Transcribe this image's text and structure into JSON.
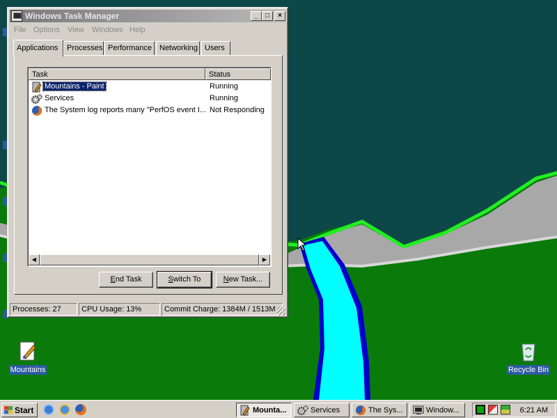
{
  "desktop": {
    "icons": [
      {
        "label": "Mountains"
      },
      {
        "label": "Recycle Bin"
      }
    ]
  },
  "window": {
    "title": "Windows Task Manager",
    "controls": {
      "minimize": "_",
      "maximize": "□",
      "close": "×"
    },
    "menu": [
      "File",
      "Options",
      "View",
      "Windows",
      "Help"
    ],
    "tabs": [
      "Applications",
      "Processes",
      "Performance",
      "Networking",
      "Users"
    ],
    "active_tab": "Applications",
    "columns": [
      "Task",
      "Status"
    ],
    "tasks": [
      {
        "name": "Mountains - Paint",
        "status": "Running",
        "icon": "paint-icon",
        "selected": true
      },
      {
        "name": "Services",
        "status": "Running",
        "icon": "services-gear-icon",
        "selected": false
      },
      {
        "name": "The System log reports many \"PerfOS event I...",
        "status": "Not Responding",
        "icon": "firefox-icon",
        "selected": false
      }
    ],
    "buttons": {
      "end_task": {
        "pre": "",
        "u": "E",
        "post": "nd Task"
      },
      "switch_to": {
        "pre": "",
        "u": "S",
        "post": "witch To"
      },
      "new_task": {
        "pre": "",
        "u": "N",
        "post": "ew Task..."
      }
    },
    "statusbar": {
      "processes": "Processes: 27",
      "cpu": "CPU Usage: 13%",
      "commit": "Commit Charge: 1384M / 1513M"
    }
  },
  "taskbar": {
    "start": "Start",
    "quick_launch": [
      "ie-icon",
      "ie-icon",
      "firefox-icon"
    ],
    "buttons": [
      {
        "label": "Mounta...",
        "icon": "paint-icon",
        "pressed": true
      },
      {
        "label": "Services",
        "icon": "services-gear-icon",
        "pressed": false
      },
      {
        "label": "The Sys...",
        "icon": "firefox-icon",
        "pressed": false
      },
      {
        "label": "Window...",
        "icon": "task-manager-icon",
        "pressed": false
      }
    ],
    "tray_icons": [
      "cpu-meter-icon",
      "network-icon",
      "security-icon"
    ],
    "clock": "6:21 AM"
  },
  "colors": {
    "sky": "#0e4747",
    "grass": "#0a7a0a",
    "ridge": "#22ee22",
    "river": "#00ffff",
    "river_edge": "#0000cc",
    "selection": "#0a246a"
  }
}
